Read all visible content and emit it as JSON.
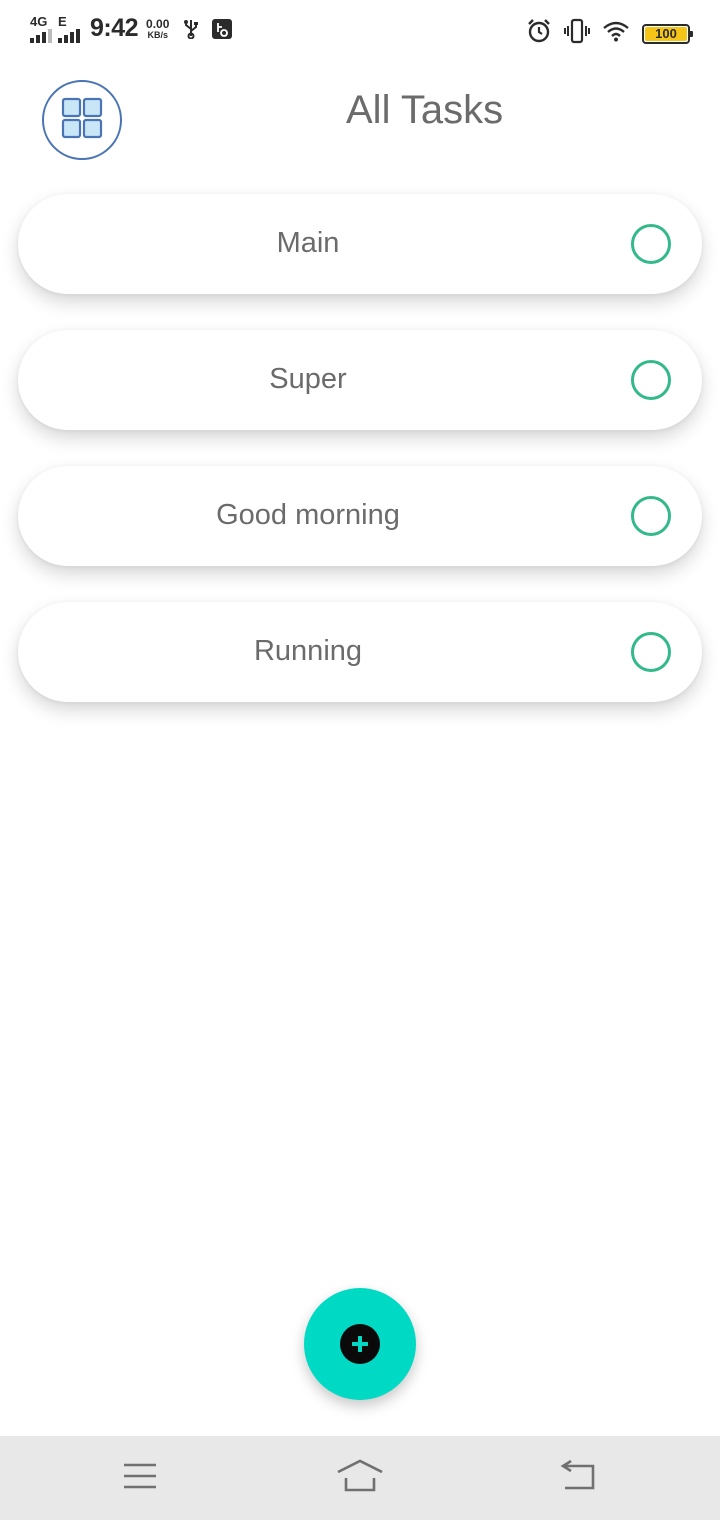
{
  "status_bar": {
    "network_1": "4G",
    "network_2": "E",
    "time": "9:42",
    "speed_value": "0.00",
    "speed_unit": "KB/s",
    "battery": "100",
    "battery_color": "#f5c518",
    "icons": [
      "usb-icon",
      "usb-debug-icon",
      "alarm-icon",
      "vibrate-icon",
      "wifi-icon",
      "battery-icon"
    ]
  },
  "header": {
    "title": "All Tasks",
    "menu_icon": "grid-icon"
  },
  "tasks": [
    {
      "name": "Main",
      "done": false
    },
    {
      "name": "Super",
      "done": false
    },
    {
      "name": "Good morning",
      "done": false
    },
    {
      "name": "Running",
      "done": false
    }
  ],
  "fab": {
    "icon": "add-icon",
    "color": "#00d9c4"
  },
  "nav_bar": {
    "icons": [
      "menu-icon",
      "home-icon",
      "back-icon"
    ]
  },
  "colors": {
    "accent": "#00d9c4",
    "check": "#33b98a",
    "menu_ring": "#4a74b4",
    "text": "#6b6b6b"
  }
}
